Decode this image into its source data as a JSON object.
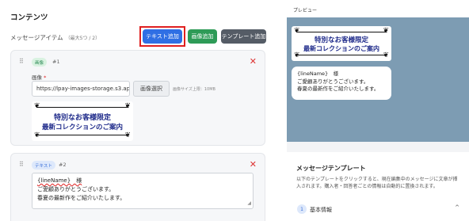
{
  "content": {
    "section_title": "コンテンツ",
    "items_label": "メッセージアイテム",
    "items_sub": "（最大5つ / 2）",
    "buttons": {
      "add_text": "テキスト追加",
      "add_image": "画像追加",
      "add_template": "テンプレート追加"
    },
    "items": [
      {
        "type_badge": "画像",
        "number": "#1",
        "field_label": "画像",
        "required_mark": "*",
        "url_value": "https://lpay-images-storage.s3.ap-nor",
        "select_button": "画像選択",
        "size_note": "画像サイズ上限：10MB",
        "banner_line1": "特別なお客様限定",
        "banner_line2": "最新コレクションのご案内"
      },
      {
        "type_badge": "テキスト",
        "number": "#2",
        "text_lines": [
          "{lineName}　様",
          "ご愛顧ありがとうございます。",
          "春夏の最新作をご紹介いたします。"
        ]
      }
    ]
  },
  "preview": {
    "title": "プレビュー",
    "banner_line1": "特別なお客様限定",
    "banner_line2": "最新コレクションのご案内",
    "bubble_lines": [
      "{lineName}　様",
      "ご愛顧ありがとうございます。",
      "春夏の最新作をご紹介いたします。"
    ]
  },
  "templates": {
    "title": "メッセージテンプレート",
    "description": "以下のテンプレートをクリックすると、現在編集中のメッセージに文章が挿入されます。購入者・回答者ごとの情報は自動的に置換されます。",
    "accordion": {
      "number": "1",
      "label": "基本情報",
      "chevron": "^"
    }
  },
  "colors": {
    "primary": "#2f6fe4",
    "success": "#2e9b57",
    "dark": "#555c66",
    "danger": "#e02020",
    "preview_bg": "#7d9cb3",
    "banner_text": "#1e2a8a"
  },
  "icons": [
    "drag-handle-icon",
    "close-icon",
    "resize-handle-icon",
    "chevron-up-icon"
  ]
}
